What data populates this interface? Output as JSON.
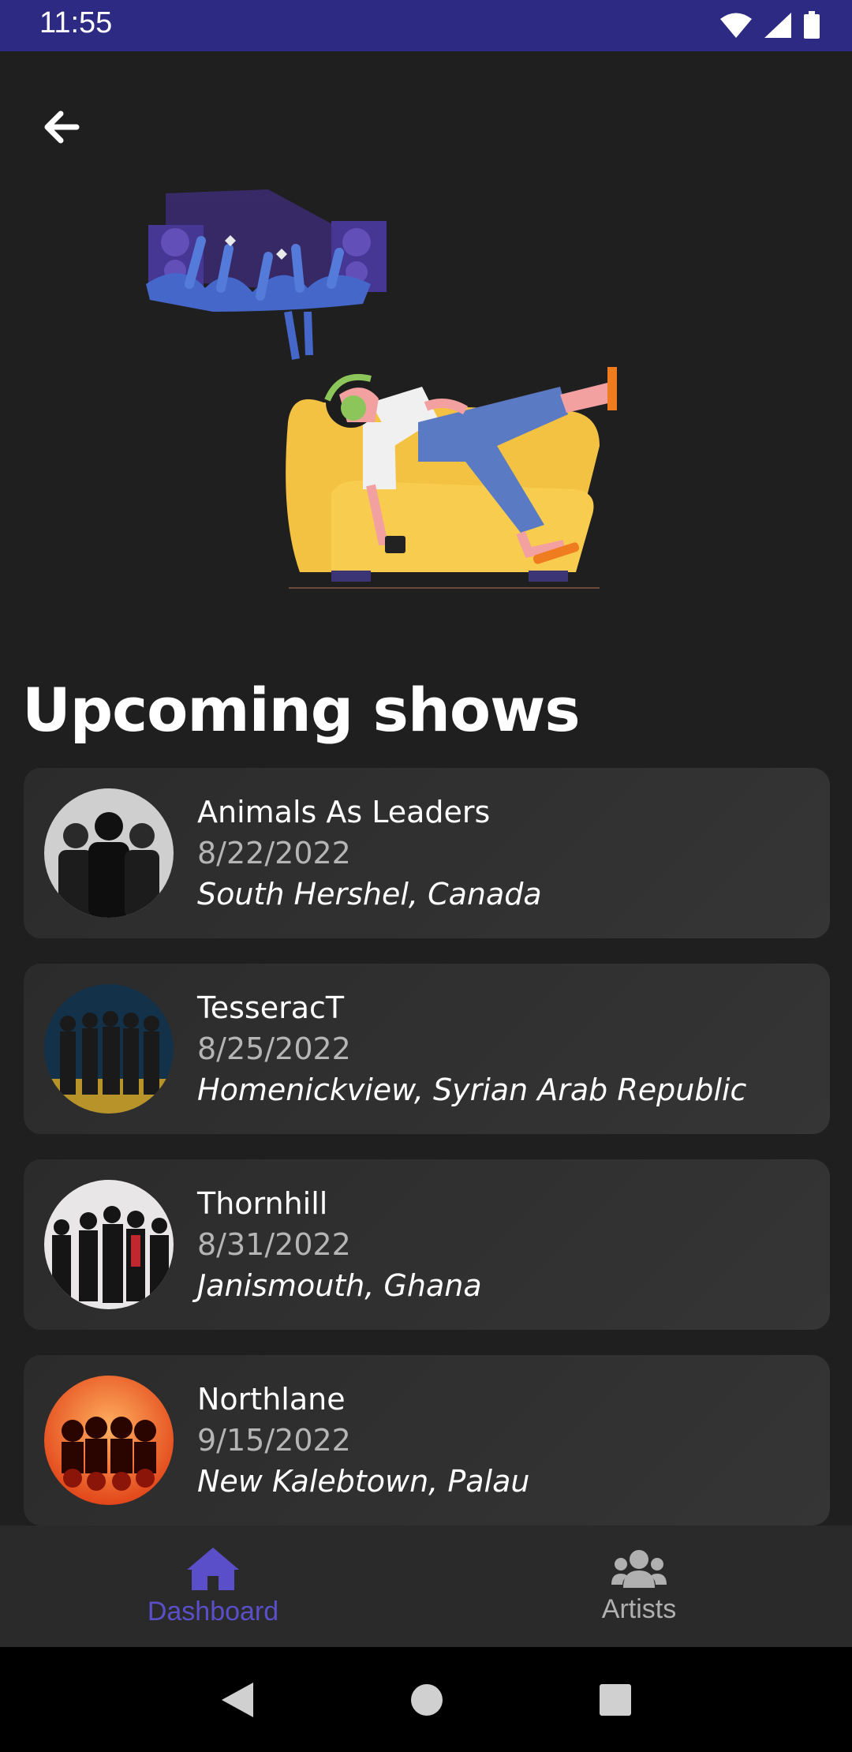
{
  "status_bar": {
    "time": "11:55"
  },
  "header": {
    "back_icon": "arrow-left-icon"
  },
  "section": {
    "title": "Upcoming shows"
  },
  "shows": [
    {
      "name": "Animals As Leaders",
      "date": "8/22/2022",
      "location": "South Hershel, Canada"
    },
    {
      "name": "TesseracT",
      "date": "8/25/2022",
      "location": "Homenickview, Syrian Arab Republic"
    },
    {
      "name": "Thornhill",
      "date": "8/31/2022",
      "location": "Janismouth, Ghana"
    },
    {
      "name": "Northlane",
      "date": "9/15/2022",
      "location": "New Kalebtown, Palau"
    }
  ],
  "bottom_nav": {
    "items": [
      {
        "label": "Dashboard",
        "icon": "home-icon",
        "active": true
      },
      {
        "label": "Artists",
        "icon": "users-icon",
        "active": false
      }
    ]
  },
  "colors": {
    "accent": "#5b4fc9",
    "status_bar": "#2c2a82",
    "background": "#1f1f1f",
    "card": "#2f2f2f"
  }
}
